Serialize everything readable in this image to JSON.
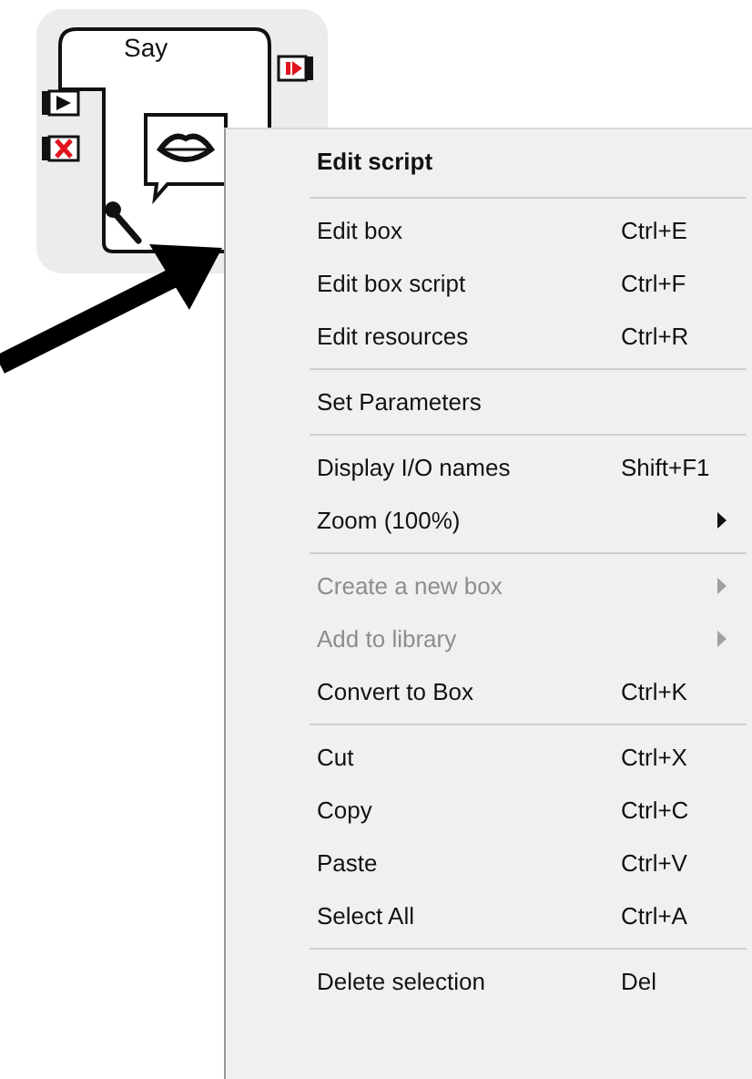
{
  "node": {
    "title": "Say"
  },
  "menu": [
    {
      "kind": "header",
      "label": "Edit script"
    },
    {
      "kind": "separator"
    },
    {
      "kind": "item",
      "label": "Edit box",
      "shortcut": "Ctrl+E",
      "disabled": false
    },
    {
      "kind": "item",
      "label": "Edit box script",
      "shortcut": "Ctrl+F",
      "disabled": false
    },
    {
      "kind": "item",
      "label": "Edit resources",
      "shortcut": "Ctrl+R",
      "disabled": false
    },
    {
      "kind": "separator"
    },
    {
      "kind": "item",
      "label": "Set Parameters",
      "disabled": false
    },
    {
      "kind": "separator"
    },
    {
      "kind": "item",
      "label": "Display I/O names",
      "shortcut": "Shift+F1",
      "disabled": false
    },
    {
      "kind": "submenu",
      "label": "Zoom (100%)",
      "disabled": false
    },
    {
      "kind": "separator"
    },
    {
      "kind": "submenu",
      "label": "Create a new box",
      "disabled": true
    },
    {
      "kind": "submenu",
      "label": "Add to library",
      "disabled": true
    },
    {
      "kind": "item",
      "label": "Convert to Box",
      "shortcut": "Ctrl+K",
      "disabled": false
    },
    {
      "kind": "separator"
    },
    {
      "kind": "item",
      "label": "Cut",
      "shortcut": "Ctrl+X",
      "disabled": false
    },
    {
      "kind": "item",
      "label": "Copy",
      "shortcut": "Ctrl+C",
      "disabled": false
    },
    {
      "kind": "item",
      "label": "Paste",
      "shortcut": "Ctrl+V",
      "disabled": false
    },
    {
      "kind": "item",
      "label": "Select All",
      "shortcut": "Ctrl+A",
      "disabled": false
    },
    {
      "kind": "separator"
    },
    {
      "kind": "item",
      "label": "Delete selection",
      "shortcut": "Del",
      "disabled": false
    }
  ]
}
